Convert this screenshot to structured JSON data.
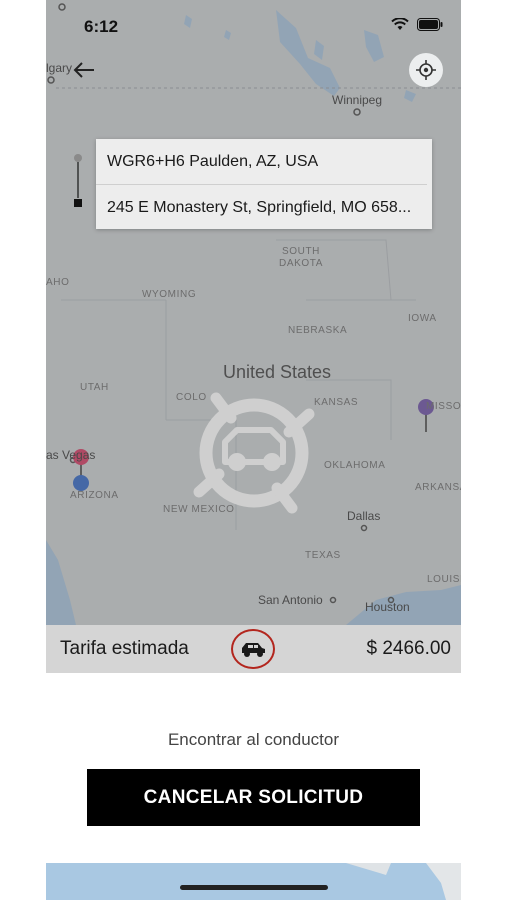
{
  "status": {
    "time": "6:12"
  },
  "route": {
    "origin": "WGR6+H6 Paulden, AZ, USA",
    "destination": "245 E Monastery St, Springfield, MO 658..."
  },
  "map": {
    "labels": {
      "calgary": "lgary",
      "winnipeg": "Winnipeg",
      "south_dakota": "SOUTH\nDAKOTA",
      "aho": "AHO",
      "wyoming": "WYOMING",
      "nebraska": "NEBRASKA",
      "iowa": "IOWA",
      "united_states": "United States",
      "utah": "UTAH",
      "colorado": "COLO",
      "kansas": "KANSAS",
      "missouri": "MISSOU",
      "las_vegas": "as Vegas",
      "arizona": "ARIZONA",
      "new_mexico": "NEW MEXICO",
      "oklahoma": "OKLAHOMA",
      "arkansas": "ARKANSA",
      "dallas": "Dallas",
      "texas": "TEXAS",
      "louisiana": "LOUISI",
      "san_antonio": "San Antonio",
      "houston": "Houston"
    }
  },
  "fare": {
    "label": "Tarifa estimada",
    "price": "$ 2466.00"
  },
  "status_text": "Encontrar al conductor",
  "cancel_label": "CANCELAR SOLICITUD",
  "colors": {
    "accent_red": "#b3261e",
    "pin_red": "#d8345f",
    "pin_blue": "#2d64c8",
    "pin_purple": "#6b4ca8"
  }
}
